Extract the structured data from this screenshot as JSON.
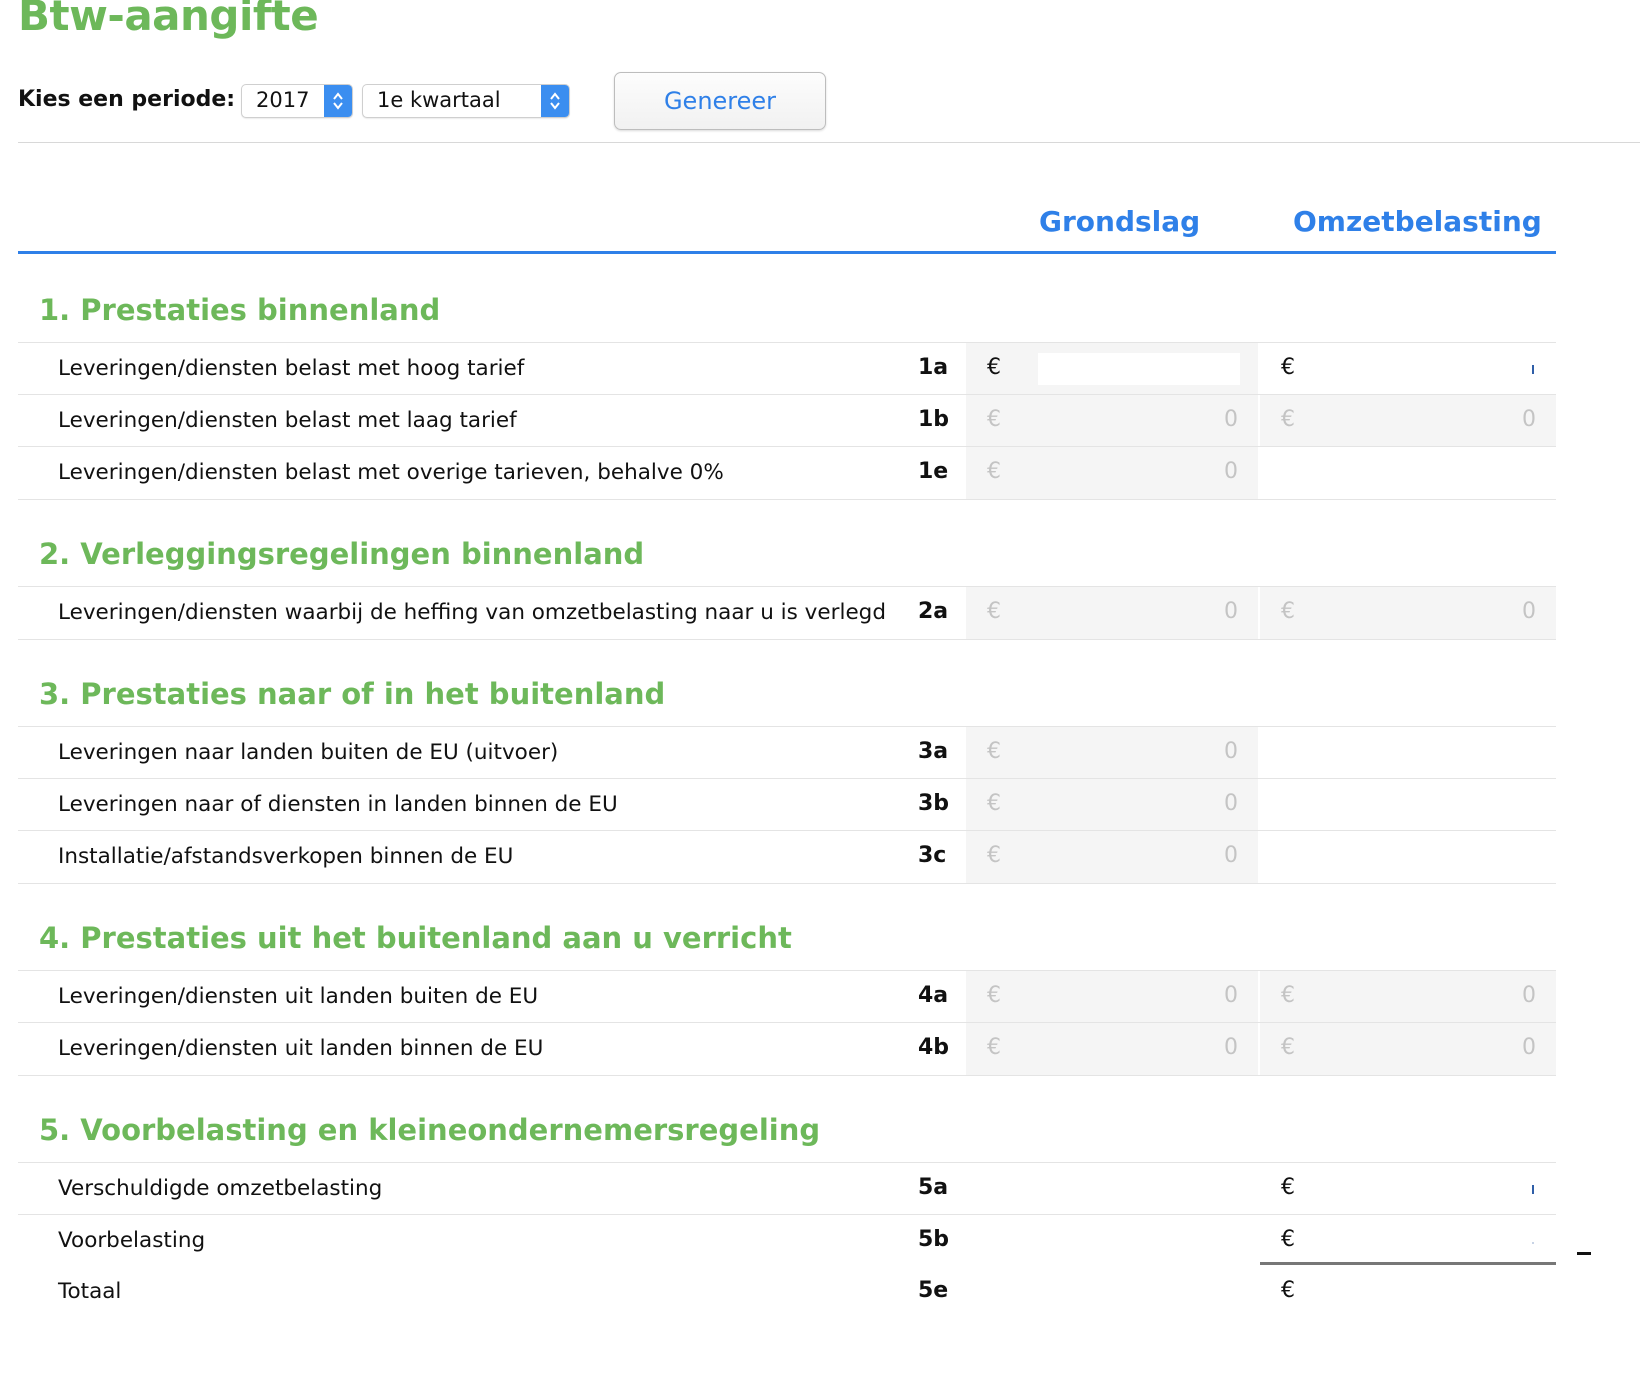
{
  "title": "Btw-aangifte",
  "period": {
    "label": "Kies een periode:",
    "year": "2017",
    "quarter": "1e kwartaal"
  },
  "generate_label": "Genereer",
  "columns": {
    "grondslag": "Grondslag",
    "omzetbelasting": "Omzetbelasting"
  },
  "currency": "€",
  "zero": "0",
  "sections": [
    {
      "title": "1. Prestaties binnenland",
      "rows": [
        {
          "label": "Leveringen/diensten belast met hoog tarief",
          "code": "1a"
        },
        {
          "label": "Leveringen/diensten belast met laag tarief",
          "code": "1b"
        },
        {
          "label": "Leveringen/diensten belast met overige tarieven, behalve 0%",
          "code": "1e"
        }
      ]
    },
    {
      "title": "2. Verleggingsregelingen binnenland",
      "rows": [
        {
          "label": "Leveringen/diensten waarbij de heffing van omzetbelasting naar u is verlegd",
          "code": "2a"
        }
      ]
    },
    {
      "title": "3. Prestaties naar of in het buitenland",
      "rows": [
        {
          "label": "Leveringen naar landen buiten de EU (uitvoer)",
          "code": "3a"
        },
        {
          "label": "Leveringen naar of diensten in landen binnen de EU",
          "code": "3b"
        },
        {
          "label": "Installatie/afstandsverkopen binnen de EU",
          "code": "3c"
        }
      ]
    },
    {
      "title": "4. Prestaties uit het buitenland aan u verricht",
      "rows": [
        {
          "label": "Leveringen/diensten uit landen buiten de EU",
          "code": "4a"
        },
        {
          "label": "Leveringen/diensten uit landen binnen de EU",
          "code": "4b"
        }
      ]
    },
    {
      "title": "5. Voorbelasting en kleineondernemersregeling",
      "rows": [
        {
          "label": "Verschuldigde omzetbelasting",
          "code": "5a"
        },
        {
          "label": "Voorbelasting",
          "code": "5b"
        },
        {
          "label": "Totaal",
          "code": "5e"
        }
      ]
    }
  ]
}
